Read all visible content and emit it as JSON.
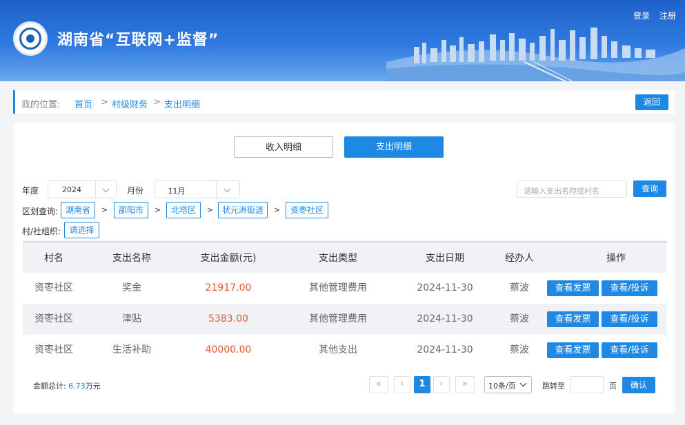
{
  "header": {
    "title": "湖南省“互联网+监督”",
    "login": "登录",
    "register": "注册",
    "logo_icon": "eye-seal-icon"
  },
  "breadcrumb": {
    "label": "我的位置:",
    "items": [
      "首页",
      "村级财务",
      "支出明细"
    ],
    "separator": ">",
    "back": "返回"
  },
  "tabs": {
    "income": "收入明细",
    "expense": "支出明细"
  },
  "filters": {
    "year_label": "年度",
    "year_value": "2024",
    "month_label": "月份",
    "month_value": "11月",
    "search_placeholder": "请输入支出名称或村名",
    "query": "查询",
    "region_label": "区划查询:",
    "regions": [
      "湖南省",
      "邵阳市",
      "北塔区",
      "状元洲街道",
      "资枣社区"
    ],
    "org_label": "村/社组织:",
    "org_select": "请选择"
  },
  "table": {
    "columns": [
      "村名",
      "支出名称",
      "支出金额(元)",
      "支出类型",
      "支出日期",
      "经办人",
      "操作"
    ],
    "rows": [
      {
        "village": "资枣社区",
        "name": "奖金",
        "amount": "21917.00",
        "type": "其他管理费用",
        "date": "2024-11-30",
        "handler": "蔡波"
      },
      {
        "village": "资枣社区",
        "name": "津贴",
        "amount": "5383.00",
        "type": "其他管理费用",
        "date": "2024-11-30",
        "handler": "蔡波"
      },
      {
        "village": "资枣社区",
        "name": "生活补助",
        "amount": "40000.00",
        "type": "其他支出",
        "date": "2024-11-30",
        "handler": "蔡波"
      }
    ],
    "btn_invoice": "查看发票",
    "btn_complain": "查看/投诉"
  },
  "footer": {
    "total_label": "金额总计:",
    "total_value": "6.73",
    "total_unit": "万元",
    "first": "«",
    "prev": "‹",
    "current_page": "1",
    "next": "›",
    "last": "»",
    "page_size": "10条/页",
    "jump_label": "跳转至",
    "page_unit": "页",
    "confirm": "确认"
  },
  "colors": {
    "primary": "#1e88e5",
    "amount": "#e4572e",
    "header_top": "#1e62c9"
  }
}
